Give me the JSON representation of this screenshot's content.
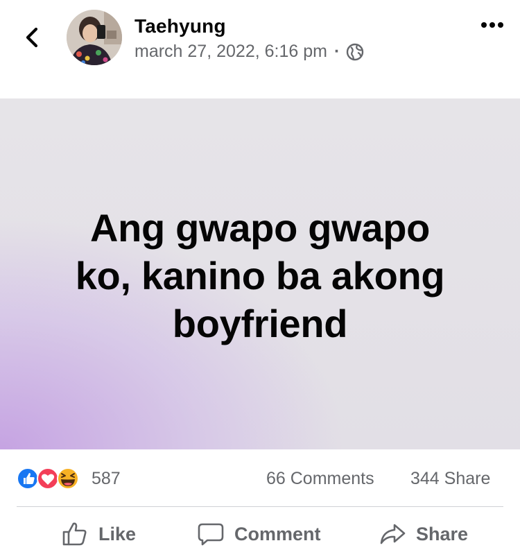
{
  "post": {
    "author": "Taehyung",
    "timestamp": "march 27, 2022, 6:16 pm",
    "separator": "·",
    "privacy_icon": "globe-icon",
    "text_lines": [
      "Ang gwapo gwapo",
      "ko, kanino ba akong",
      "boyfriend"
    ],
    "background": {
      "base": "#e3e1e6",
      "accent": "#c3a0e2"
    }
  },
  "stats": {
    "reaction_icons": [
      "like-icon",
      "love-icon",
      "haha-icon"
    ],
    "reaction_count": "587",
    "comments": "66 Comments",
    "shares": "344 Share"
  },
  "actions": {
    "like": "Like",
    "comment": "Comment",
    "share": "Share"
  },
  "colors": {
    "like_blue": "#1877f2",
    "love_red": "#f33e58",
    "haha_yellow": "#f7b125",
    "secondary_text": "#65676b"
  }
}
